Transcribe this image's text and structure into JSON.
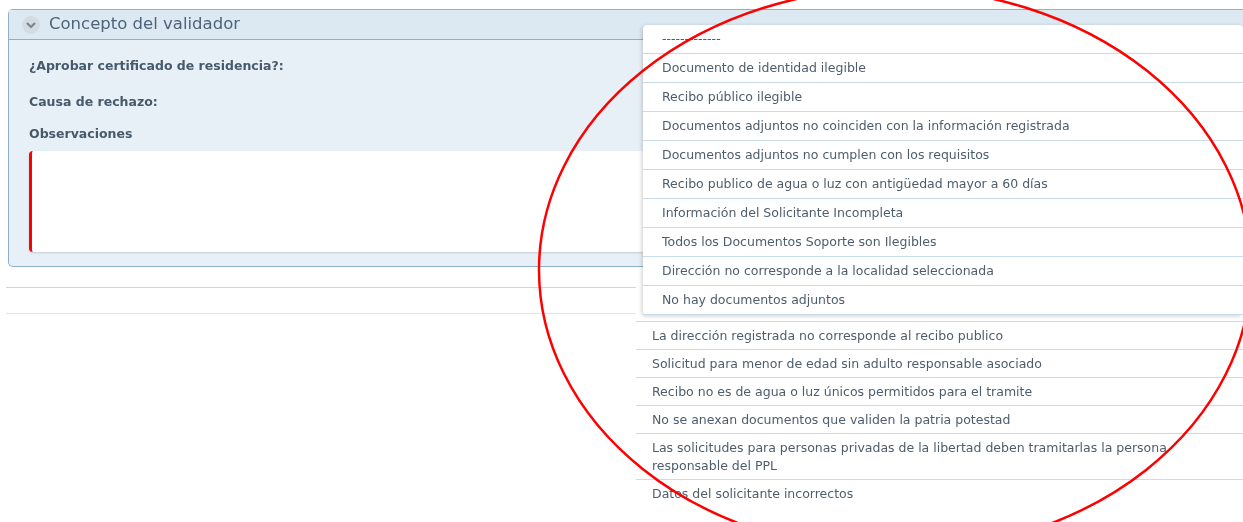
{
  "panel": {
    "title": "Concepto del validador",
    "expanded": true,
    "fields": [
      {
        "label": "¿Aprobar certificado de residencia?:"
      },
      {
        "label": "Causa de rechazo:"
      },
      {
        "label": "Observaciones"
      }
    ],
    "observations": {
      "invalid": true
    }
  },
  "dropdown": {
    "options": [
      {
        "label": "-------------"
      },
      {
        "label": "Documento de identidad ilegible"
      },
      {
        "label": "Recibo público ilegible"
      },
      {
        "label": "Documentos adjuntos no coinciden con la información registrada"
      },
      {
        "label": "Documentos adjuntos no cumplen con los requisitos"
      },
      {
        "label": "Recibo publico de agua o luz con antigüedad mayor a 60 días"
      },
      {
        "label": "Información del Solicitante Incompleta"
      },
      {
        "label": "Todos los Documentos Soporte son Ilegibles"
      },
      {
        "label": "Dirección no corresponde a la localidad seleccionada"
      },
      {
        "label": "No hay documentos adjuntos"
      }
    ]
  },
  "more_options": [
    {
      "label": "La dirección registrada no corresponde al recibo publico"
    },
    {
      "label": "Solicitud para menor de edad sin adulto responsable asociado"
    },
    {
      "label": "Recibo no es de agua o luz únicos permitidos para el tramite"
    },
    {
      "label": "No se anexan documentos que validen la patria potestad"
    },
    {
      "label": "Las solicitudes para personas privadas de la libertad deben tramitarlas la persona responsable del PPL"
    },
    {
      "label": "Datos del solicitante incorrectos"
    }
  ]
}
